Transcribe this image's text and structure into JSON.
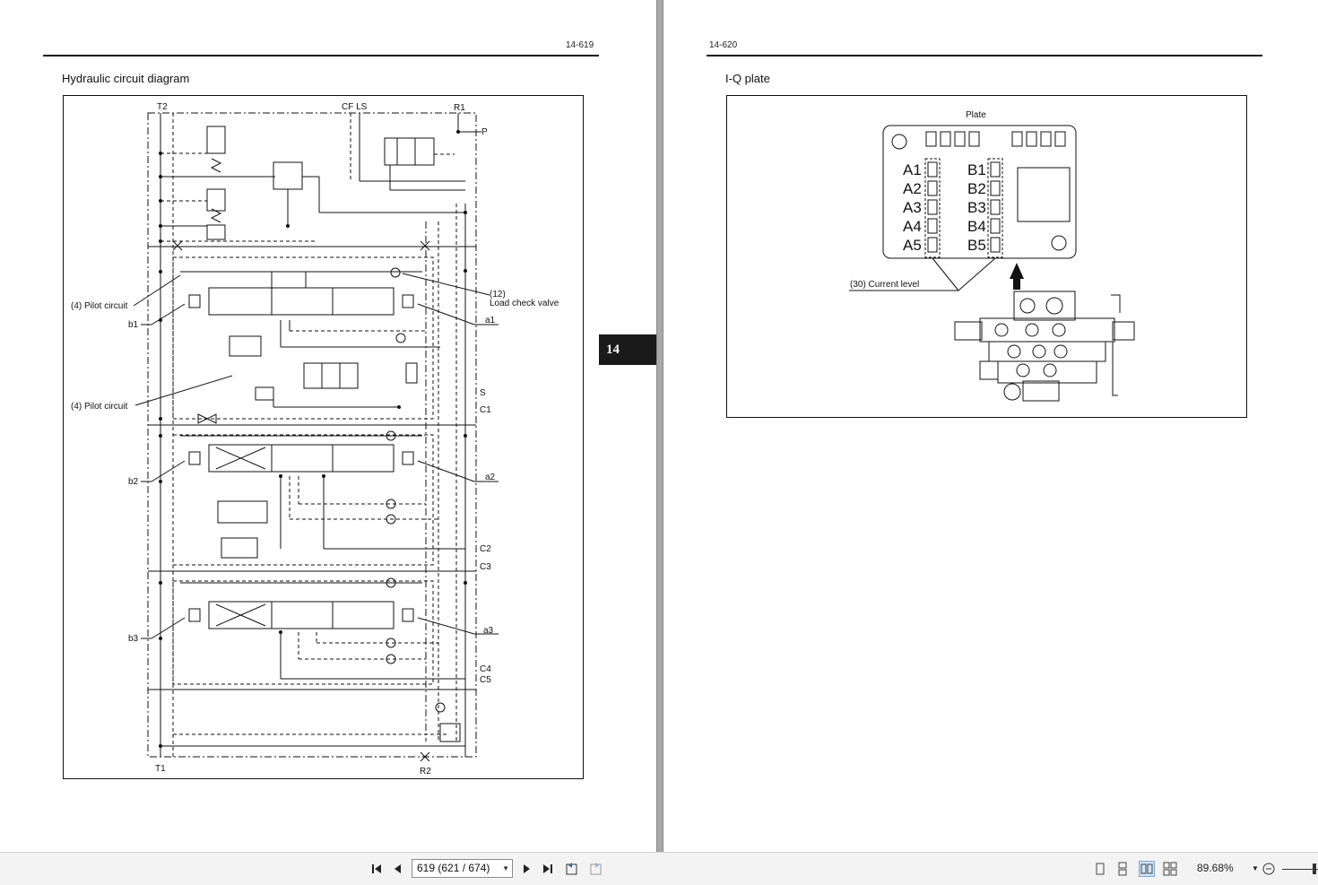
{
  "left_page": {
    "page_number": "14-619",
    "title": "Hydraulic circuit diagram",
    "labels": {
      "t2": "T2",
      "cf_ls": "CF LS",
      "r1": "R1",
      "p": "P",
      "pilot1": "(4) Pilot circuit",
      "pilot2": "(4) Pilot circuit",
      "b1": "b1",
      "b2": "b2",
      "b3": "b3",
      "a1": "a1",
      "a2": "a2",
      "a3": "a3",
      "lcv_num": "(12)",
      "lcv_text": "Load check valve",
      "s": "S",
      "c1": "C1",
      "c2": "C2",
      "c3": "C3",
      "c4": "C4",
      "c5": "C5",
      "t1": "T1",
      "r2": "R2"
    }
  },
  "chapter_tab": "14",
  "right_page": {
    "page_number": "14-620",
    "title": "I-Q plate",
    "plate_label": "Plate",
    "current_level_label": "(30) Current level",
    "a_rows": [
      "A1",
      "A2",
      "A3",
      "A4",
      "A5"
    ],
    "b_rows": [
      "B1",
      "B2",
      "B3",
      "B4",
      "B5"
    ]
  },
  "toolbar": {
    "page_value": "619 (621 / 674)",
    "zoom": "89.68%",
    "icons": {
      "first": "first-page-icon",
      "prev": "previous-page-icon",
      "next": "next-page-icon",
      "last": "last-page-icon",
      "back": "previous-view-icon",
      "forward": "next-view-icon",
      "single": "single-page-view-icon",
      "continuous": "continuous-view-icon",
      "facing": "facing-pages-view-icon",
      "facing_cont": "continuous-facing-view-icon",
      "zoom_out": "zoom-out-icon"
    },
    "active_view": "facing"
  }
}
